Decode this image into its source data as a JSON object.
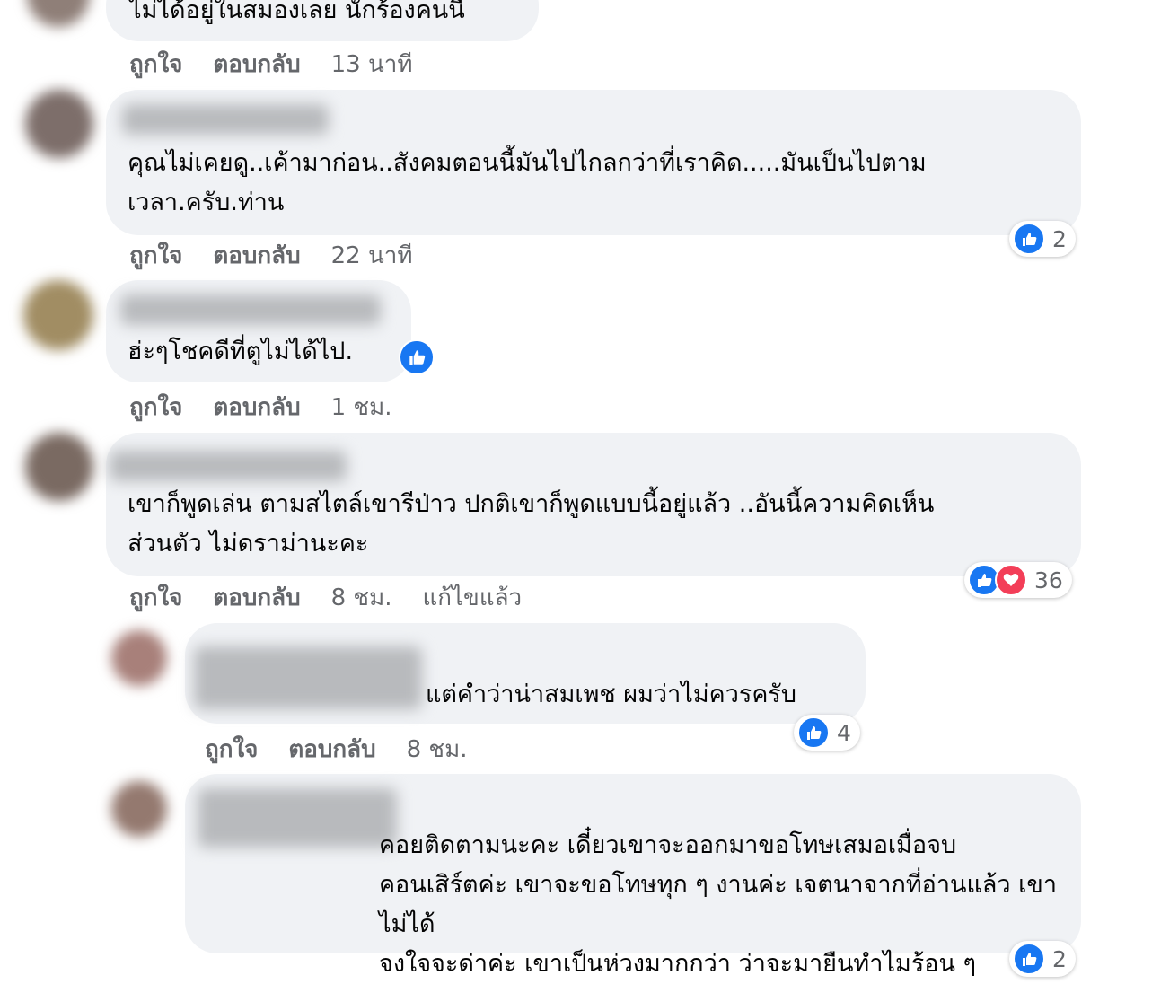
{
  "colors": {
    "bubble": "#f0f2f5",
    "meta_text": "#65676b",
    "like_blue": "#1877f2",
    "love_red": "#f33e58"
  },
  "icons": {
    "like": "thumbs-up-icon",
    "love": "heart-icon"
  },
  "comments": [
    {
      "text": "ไม่ได้อยู่ในสมองเลย นักร้องคนนี้",
      "like_label": "ถูกใจ",
      "reply_label": "ตอบกลับ",
      "time": "13 นาที"
    },
    {
      "text": "คุณไม่เคยดู..เค้ามาก่อน..สังคมตอนนี้มันไปไกลกว่าที่เราคิด.....มันเป็นไปตาม\nเวลา.ครับ.ท่าน",
      "like_label": "ถูกใจ",
      "reply_label": "ตอบกลับ",
      "time": "22 นาที",
      "reaction_count": "2"
    },
    {
      "text": "ฮ่ะๆโชคดีที่ตูไม่ได้ไป.",
      "like_label": "ถูกใจ",
      "reply_label": "ตอบกลับ",
      "time": "1 ชม."
    },
    {
      "text": "เขาก็พูดเล่น ตามสไตล์เขารีป่าว ปกติเขาก็พูดแบบนี้อยู่แล้ว ..อันนี้ความคิดเห็น\nส่วนตัว ไม่ดราม่านะคะ",
      "like_label": "ถูกใจ",
      "reply_label": "ตอบกลับ",
      "time": "8 ชม.",
      "edited": "แก้ไขแล้ว",
      "reaction_count": "36"
    },
    {
      "text": "แต่คำว่าน่าสมเพช ผมว่าไม่ควรครับ",
      "like_label": "ถูกใจ",
      "reply_label": "ตอบกลับ",
      "time": "8 ชม.",
      "reaction_count": "4"
    },
    {
      "text": "คอยติดตามนะคะ เดี๋ยวเขาจะออกมาขอโทษเสมอเมื่อจบ\nคอนเสิร์ตค่ะ เขาจะขอโทษทุก ๆ งานค่ะ เจตนาจากที่อ่านแล้ว เขาไม่ได้\nจงใจจะด่าค่ะ เขาเป็นห่วงมากกว่า ว่าจะมายืนทำไมร้อน ๆ",
      "reaction_count": "2"
    }
  ]
}
